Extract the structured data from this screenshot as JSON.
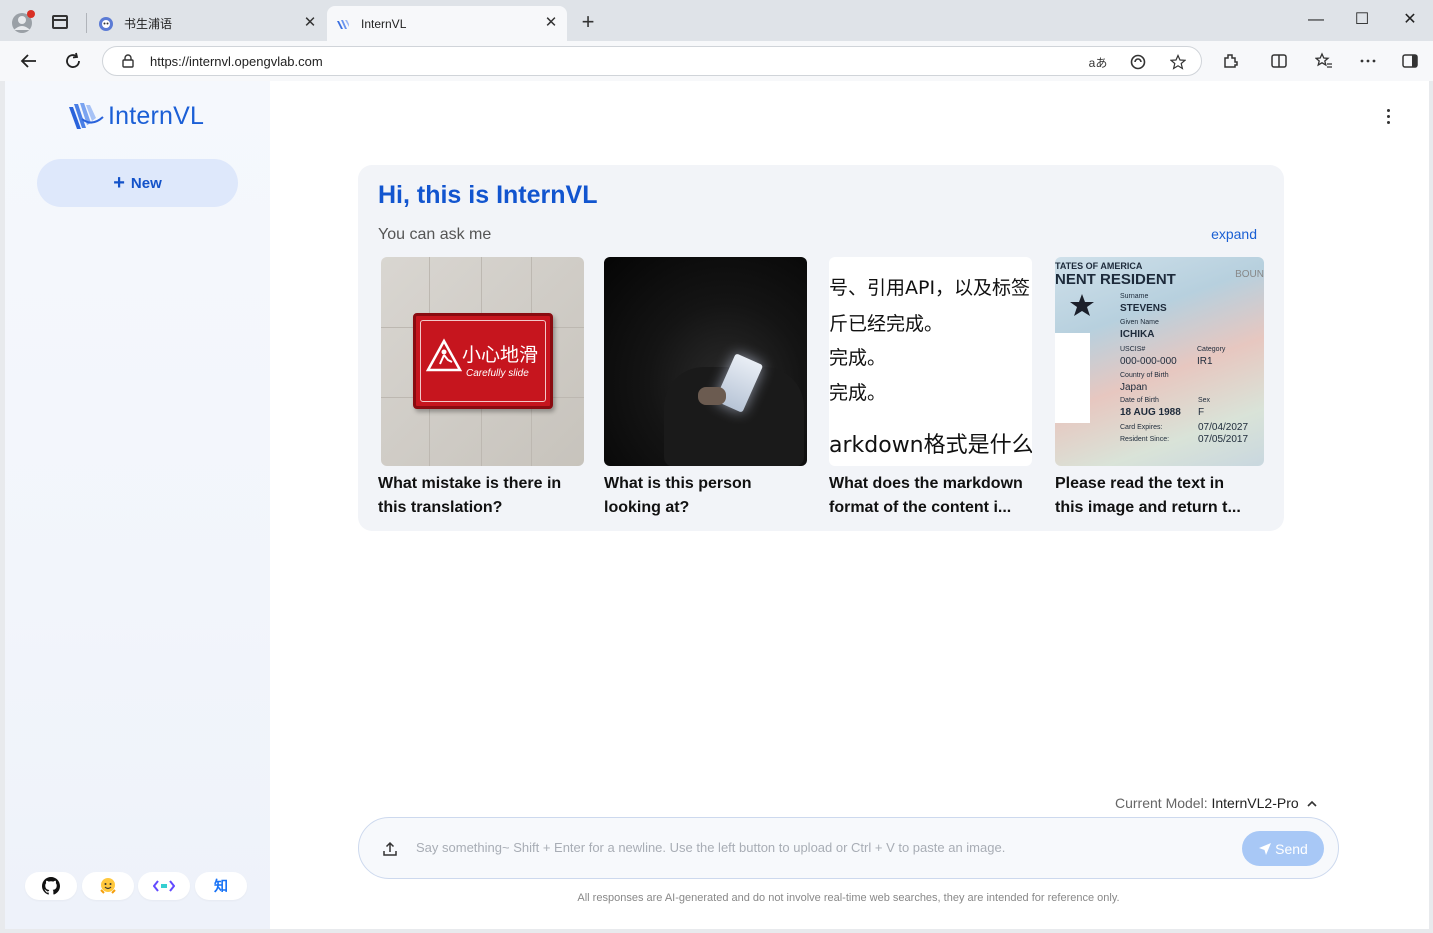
{
  "browser": {
    "tabs": [
      {
        "title": "书生浦语"
      },
      {
        "title": "InternVL"
      }
    ],
    "url": "https://internvl.opengvlab.com",
    "window_controls": {
      "minimize": "—",
      "maximize": "☐",
      "close": "✕"
    }
  },
  "sidebar": {
    "logo_text": "InternVL",
    "new_button_label": "New",
    "social_links": [
      {
        "icon": "github-icon"
      },
      {
        "icon": "huggingface-icon"
      },
      {
        "icon": "modelscope-icon"
      },
      {
        "icon": "zhihu-icon",
        "glyph": "知"
      }
    ]
  },
  "main": {
    "greeting": "Hi, this is InternVL",
    "subtitle": "You can ask me",
    "expand_label": "expand",
    "cards": [
      {
        "line1": "What mistake is there in",
        "line2": "this translation?",
        "image_text": [
          "小心地滑",
          "Carefully slide"
        ]
      },
      {
        "line1": "What is this person",
        "line2": "looking at?"
      },
      {
        "line1": "What does the markdown",
        "line2": "format of the content i...",
        "image_text": [
          "号、引用API，以及标签",
          "斤已经完成。",
          "完成。",
          "完成。",
          "arkdown格式是什么"
        ]
      },
      {
        "line1": "Please read the text in",
        "line2": "this image and return t...",
        "image_text": {
          "header1": "TATES OF AMERICA",
          "header2": "NENT RESIDENT",
          "corner": "BOUN",
          "surname_label": "Surname",
          "surname": "STEVENS",
          "given_label": "Given Name",
          "given": "ICHIKA",
          "uscis_label": "USCIS#",
          "uscis": "000-000-000",
          "category_label": "Category",
          "category": "IR1",
          "country_label": "Country of Birth",
          "country": "Japan",
          "dob_label": "Date of Birth",
          "dob": "18 AUG 1988",
          "sex_label": "Sex",
          "sex": "F",
          "expires_label": "Card Expires:",
          "expires": "07/04/2027",
          "since_label": "Resident Since:",
          "since": "07/05/2017"
        }
      }
    ],
    "model_label": "Current Model:",
    "model_value": "InternVL2-Pro",
    "input_placeholder": "Say something~ Shift + Enter for a newline. Use the left button to upload or Ctrl + V to paste an image.",
    "send_label": "Send",
    "disclaimer": "All responses are AI-generated and do not involve real-time web searches, they are intended for reference only."
  },
  "colors": {
    "accent": "#1255cf",
    "new_button_bg": "#dee8fb",
    "send_button_bg": "#a8c8f6",
    "card_bg": "#f2f4f8"
  }
}
